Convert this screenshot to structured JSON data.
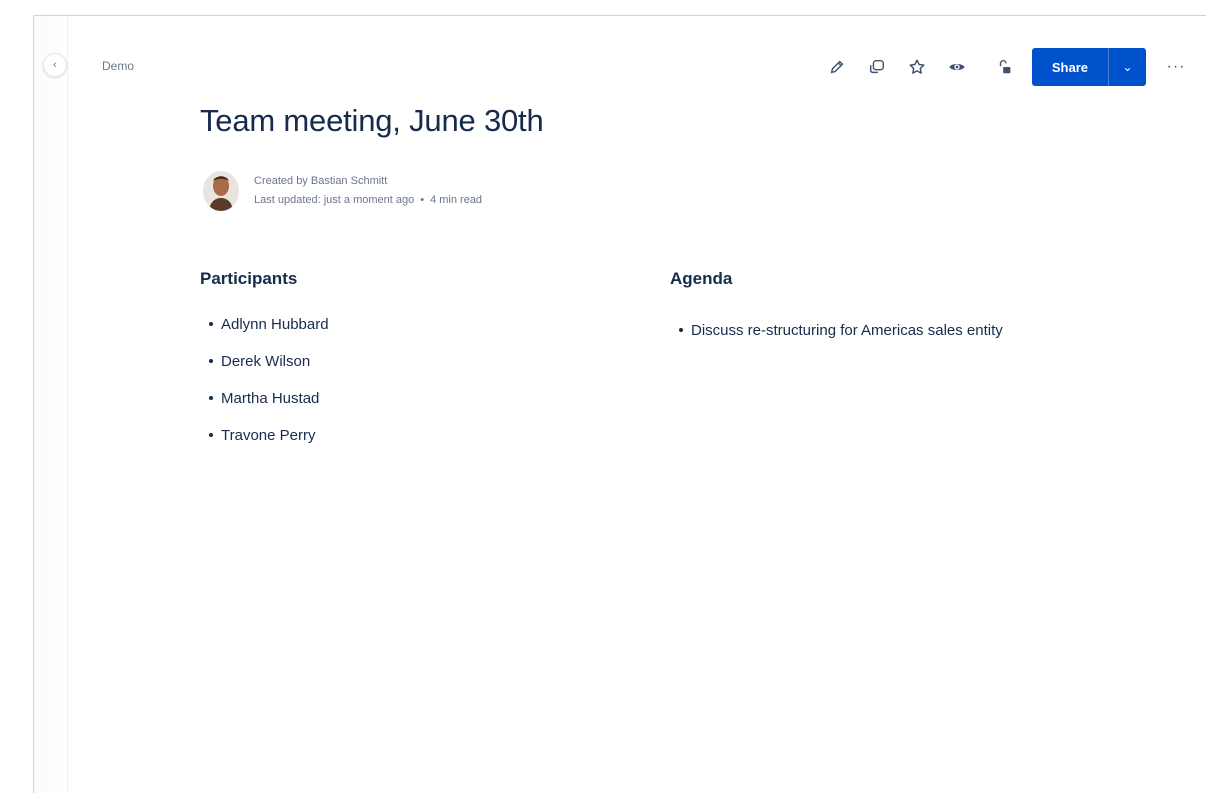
{
  "sidebar": {
    "collapse_glyph": "‹",
    "collapse_icon": "chevron-left-icon"
  },
  "breadcrumb": {
    "label": "Demo"
  },
  "toolbar": {
    "icons": [
      "pencil-icon",
      "comment-icon",
      "star-icon",
      "eye-icon",
      "restrictions-icon"
    ],
    "share_label": "Share",
    "share_caret": "⌄",
    "more_label": "···"
  },
  "page": {
    "title": "Team meeting, June 30th",
    "created_by": "Created by Bastian Schmitt",
    "last_updated": "Last updated: just a moment ago",
    "separator": "•",
    "read_time": "4 min read"
  },
  "participants": {
    "heading": "Participants",
    "items": [
      "Adlynn Hubbard",
      "Derek Wilson",
      "Martha Hustad",
      "Travone Perry"
    ]
  },
  "agenda": {
    "heading": "Agenda",
    "items": [
      "Discuss re-structuring for Americas sales entity"
    ]
  },
  "colors": {
    "accent": "#0052cc",
    "text": "#172b4d",
    "subtle": "#6b778c"
  }
}
